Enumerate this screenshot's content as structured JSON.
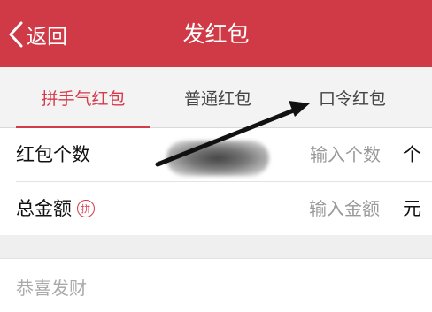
{
  "header": {
    "back_label": "返回",
    "title": "发红包"
  },
  "tabs": [
    {
      "label": "拼手气红包",
      "active": true
    },
    {
      "label": "普通红包",
      "active": false
    },
    {
      "label": "口令红包",
      "active": false
    }
  ],
  "form": {
    "count": {
      "label": "红包个数",
      "placeholder": "输入个数",
      "unit": "个"
    },
    "amount": {
      "label": "总金额",
      "badge": "拼",
      "placeholder": "输入金额",
      "unit": "元"
    }
  },
  "greeting": {
    "placeholder": "恭喜发财"
  },
  "colors": {
    "header_bg": "#cf3a46",
    "accent": "#d5394a"
  },
  "icons": {
    "back": "chevron-left-icon",
    "annotation": "arrow-annotation"
  }
}
